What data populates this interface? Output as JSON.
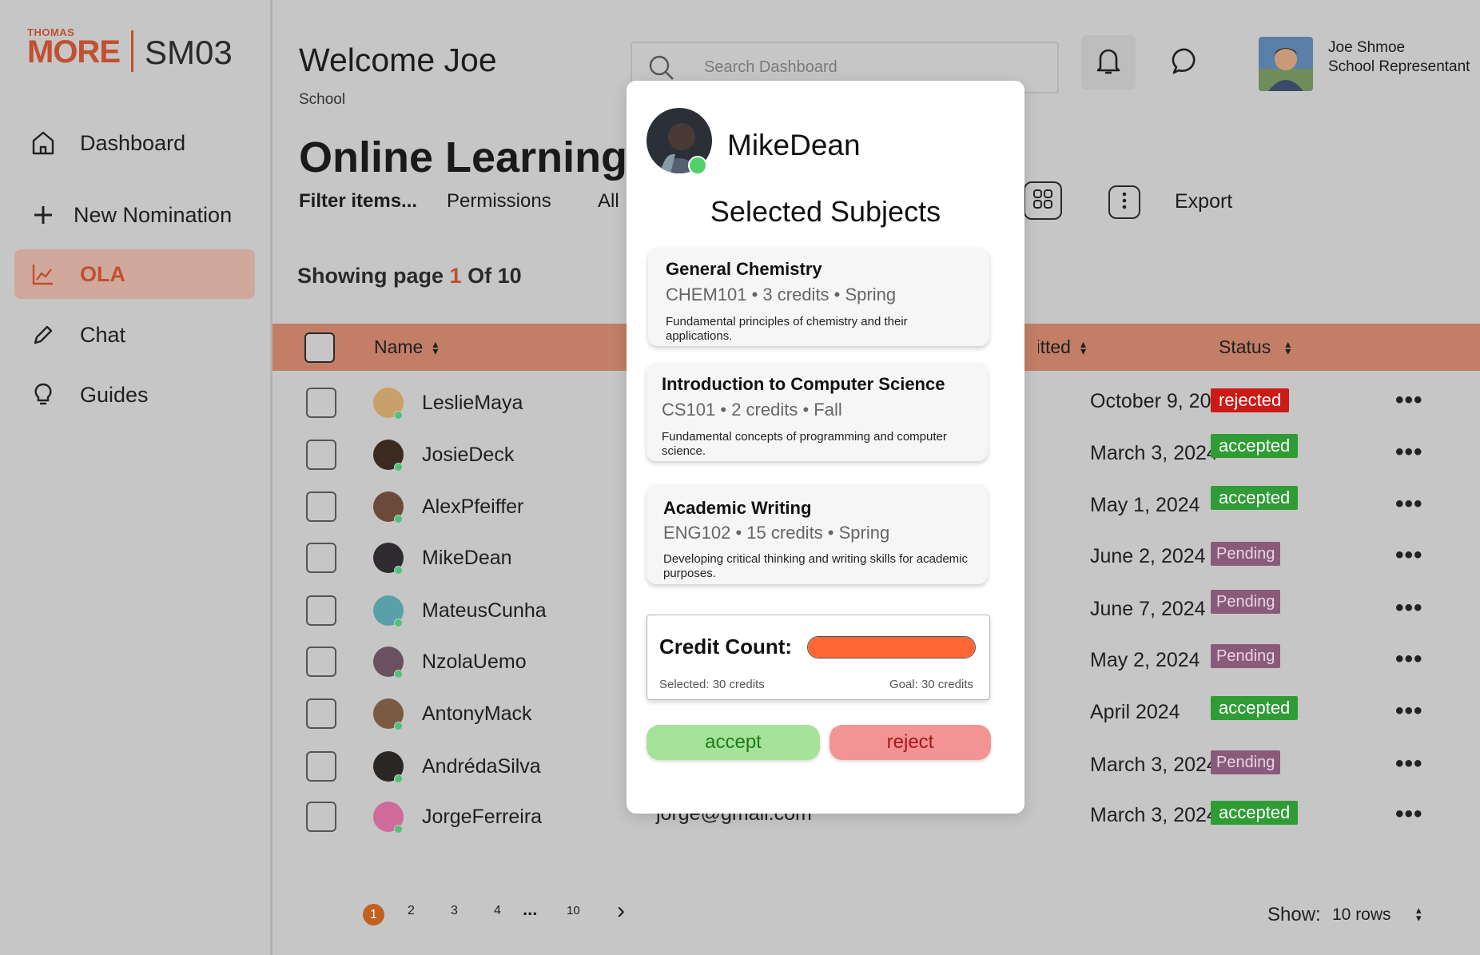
{
  "brand": {
    "top": "THOMAS",
    "name": "MORE",
    "code": "SM03"
  },
  "sidebar": {
    "items": [
      {
        "label": "Dashboard",
        "icon": "home-icon"
      },
      {
        "label": "New Nomination",
        "icon": "plus-icon"
      },
      {
        "label": "OLA",
        "icon": "chart-icon",
        "active": true
      },
      {
        "label": "Chat",
        "icon": "pencil-icon"
      },
      {
        "label": "Guides",
        "icon": "lightbulb-icon"
      }
    ]
  },
  "header": {
    "welcome": "Welcome Joe",
    "role_org": "School",
    "search_placeholder": "Search Dashboard",
    "user_name": "Joe Shmoe",
    "user_role": "School Representant"
  },
  "main": {
    "title": "Online Learning Agreements",
    "toolbar": {
      "filter": "Filter items...",
      "permissions": "Permissions",
      "all": "All",
      "export": "Export"
    },
    "showing": {
      "prefix": "Showing page",
      "current": "1",
      "suffix": "Of 10"
    },
    "columns": {
      "name": "Name",
      "submitted": "Submitted",
      "status": "Status"
    },
    "rows": [
      {
        "name": "LeslieMaya",
        "date": "October 9, 2024",
        "status": "rejected",
        "avatar": "#c9a06a"
      },
      {
        "name": "JosieDeck",
        "date": "March 3, 2024",
        "status": "accepted",
        "avatar": "#3b2a20"
      },
      {
        "name": "AlexPfeiffer",
        "date": "May 1, 2024",
        "status": "accepted",
        "avatar": "#6b4a3a"
      },
      {
        "name": "MikeDean",
        "date": "June 2, 2024",
        "status": "Pending",
        "avatar": "#2e2a30"
      },
      {
        "name": "MateusCunha",
        "date": "June 7, 2024",
        "status": "Pending",
        "avatar": "#5aa0a8"
      },
      {
        "name": "NzolaUemo",
        "date": "May 2, 2024",
        "status": "Pending",
        "avatar": "#6a5060"
      },
      {
        "name": "AntonyMack",
        "date": "April 2024",
        "status": "accepted",
        "avatar": "#7a5a40"
      },
      {
        "name": "AndrédaSilva",
        "date": "March 3, 2024",
        "status": "Pending",
        "avatar": "#2a2624"
      },
      {
        "name": "JorgeFerreira",
        "email": "jorge@gmail.com",
        "date": "March 3, 2024",
        "status": "accepted",
        "avatar": "#d06a9a"
      }
    ],
    "pagination": {
      "pages": [
        "1",
        "2",
        "3",
        "4"
      ],
      "ellipsis": "...",
      "last": "10",
      "next": "›",
      "show_label": "Show:",
      "show_value": "10 rows"
    }
  },
  "modal": {
    "student": "MikeDean",
    "heading": "Selected Subjects",
    "subjects": [
      {
        "title": "General Chemistry",
        "meta": "CHEM101 • 3 credits • Spring",
        "desc": "Fundamental principles of chemistry and their applications."
      },
      {
        "title": "Introduction to Computer Science",
        "meta": "CS101 • 2 credits • Fall",
        "desc": "Fundamental concepts of programming and computer science."
      },
      {
        "title": "Academic Writing",
        "meta": "ENG102 • 15 credits • Spring",
        "desc": "Developing critical thinking and writing skills for academic purposes."
      }
    ],
    "credit": {
      "label": "Credit Count:",
      "selected": "Selected: 30 credits",
      "goal": "Goal: 30 credits",
      "progress": 1.0,
      "color": "#ff6535"
    },
    "accept": "accept",
    "reject": "reject"
  }
}
